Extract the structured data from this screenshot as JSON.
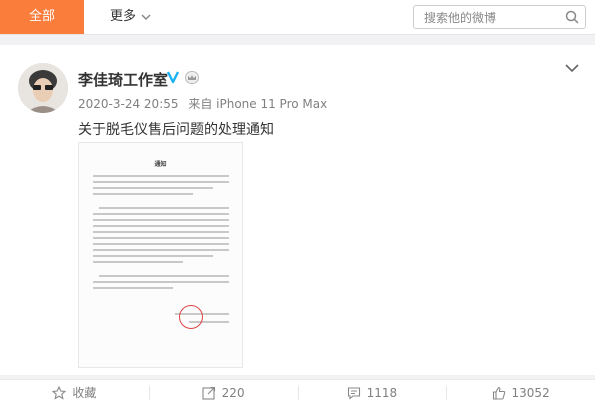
{
  "nav": {
    "tab_all": "全部",
    "tab_more": "更多",
    "search_placeholder": "搜索他的微博"
  },
  "post": {
    "username": "李佳琦工作室",
    "timestamp": "2020-3-24 20:55",
    "source": "来自 iPhone 11 Pro Max",
    "text": "关于脱毛仪售后问题的处理通知",
    "image": {
      "heading": "通知"
    }
  },
  "actions": {
    "favorite_label": "收藏",
    "repost_count": "220",
    "comment_count": "1118",
    "like_count": "13052"
  },
  "icons": [
    "chevron-down-icon",
    "search-icon",
    "verified-icon",
    "member-crown-icon",
    "star-icon",
    "repost-icon",
    "comment-icon",
    "like-icon"
  ],
  "colors": {
    "accent": "#fa7d3c",
    "verified": "#19b3f2"
  }
}
